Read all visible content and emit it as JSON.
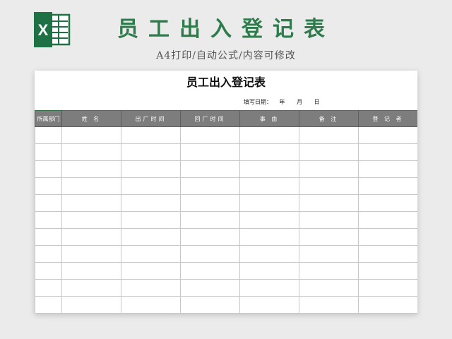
{
  "banner": {
    "title": "员工出入登记表",
    "subtitle": "A4打印/自动公式/内容可修改"
  },
  "logo": {
    "icon": "excel-icon",
    "letter": "X",
    "color": "#1e7145"
  },
  "sheet": {
    "title": "员工出入登记表",
    "fill_date": {
      "label": "填写日期：",
      "year": "年",
      "month": "月",
      "day": "日"
    },
    "columns": [
      "所属部门",
      "姓 名",
      "出厂时间",
      "回厂时间",
      "事 由",
      "备 注",
      "登 记 者"
    ],
    "row_count": 11
  },
  "colors": {
    "accent": "#2e7b4b",
    "header_bg": "#7d7d7d",
    "grid_line": "#c8c8c8",
    "page_bg": "#ebebeb"
  }
}
